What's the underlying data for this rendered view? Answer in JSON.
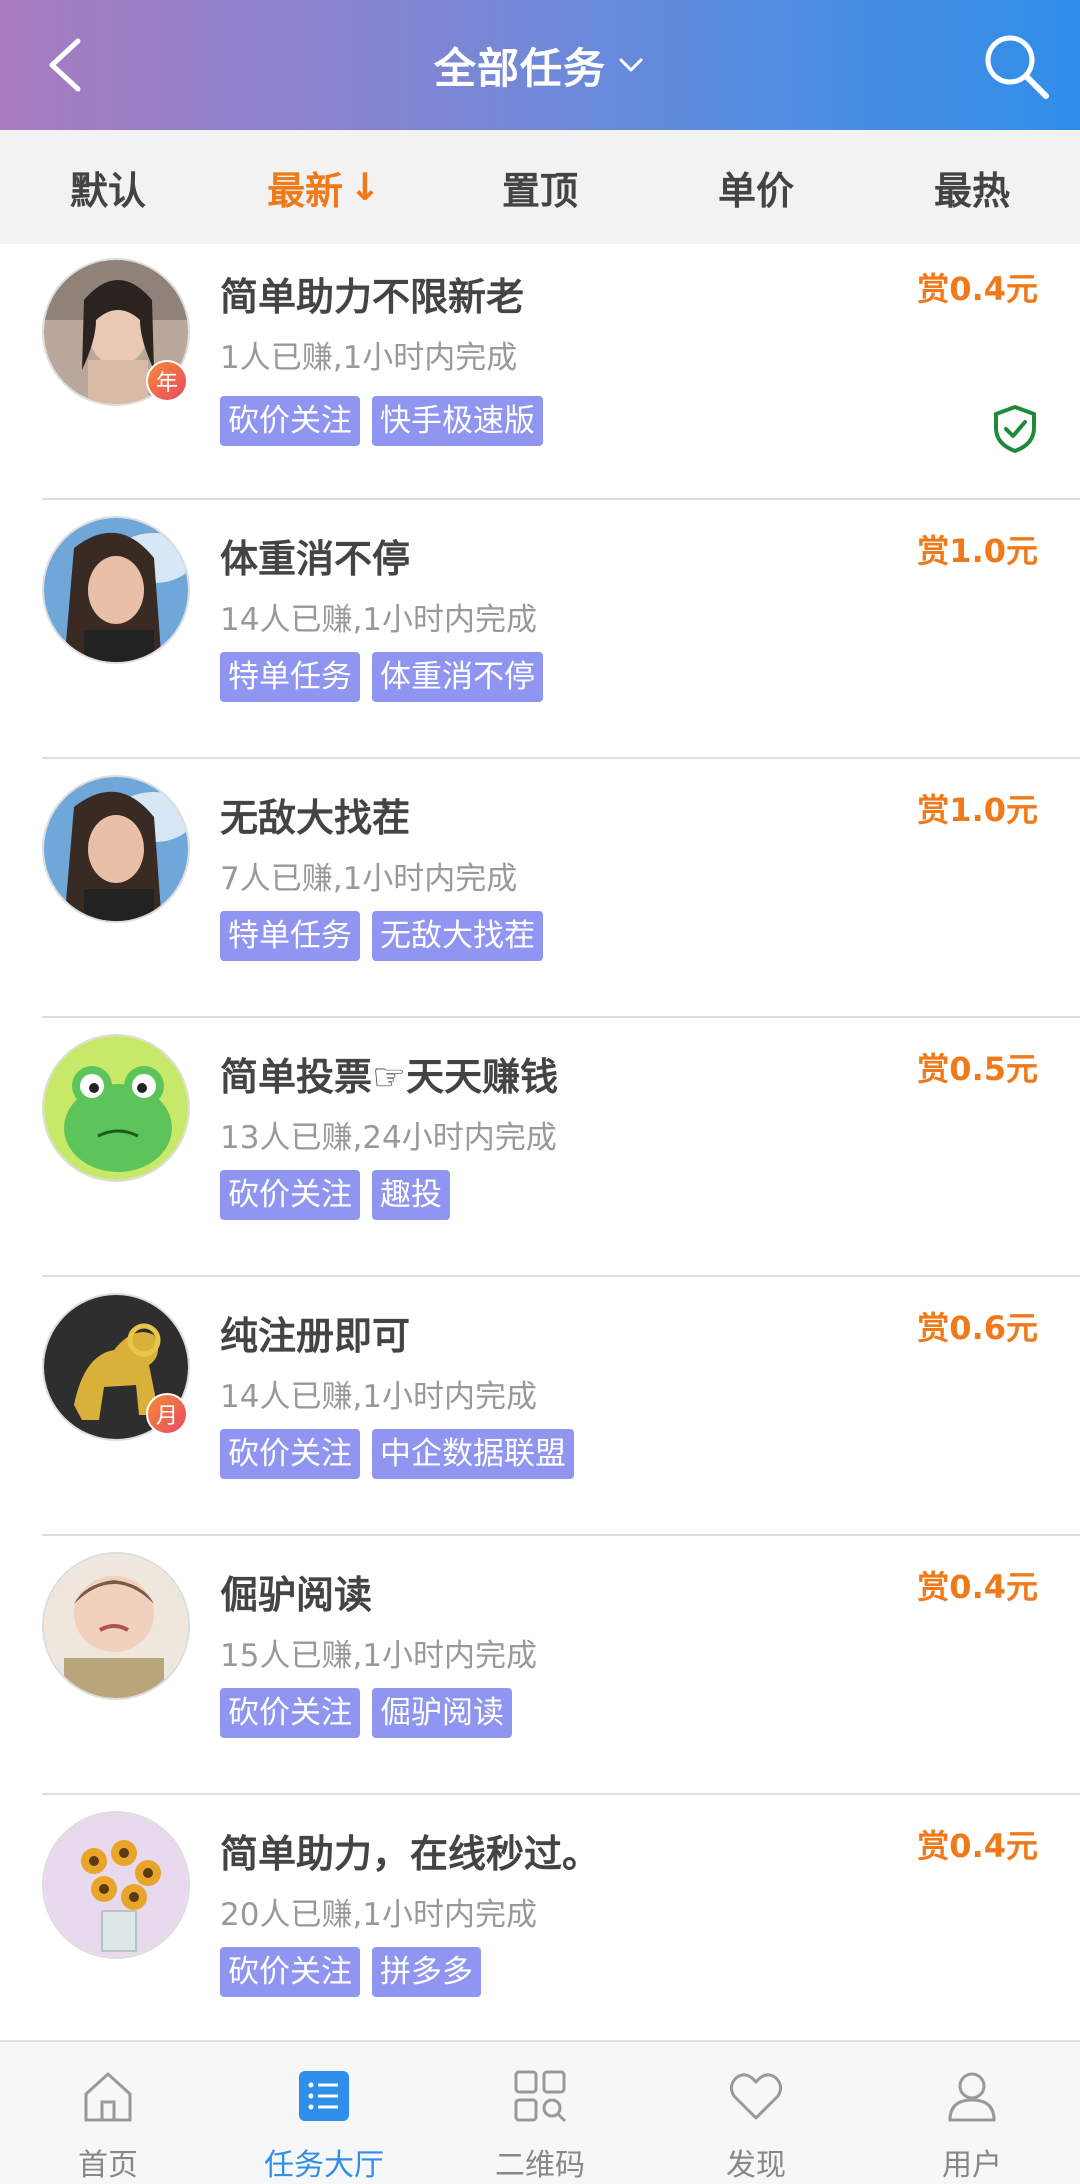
{
  "header": {
    "title": "全部任务",
    "icons": {
      "back": "chevron-left-icon",
      "dropdown": "chevron-down-icon",
      "search": "search-icon"
    },
    "colors": {
      "gradient_start": "#a87bbf",
      "gradient_end": "#2f8ee8"
    }
  },
  "sort": {
    "items": [
      {
        "label": "默认",
        "active": false
      },
      {
        "label": "最新",
        "active": true,
        "arrow": "↓"
      },
      {
        "label": "置顶",
        "active": false
      },
      {
        "label": "单价",
        "active": false
      },
      {
        "label": "最热",
        "active": false
      }
    ],
    "active_color": "#f07a1a"
  },
  "tasks": [
    {
      "title": "简单助力不限新老",
      "meta": "1人已赚,1小时内完成",
      "tags": [
        "砍价关注",
        "快手极速版"
      ],
      "reward": "赏0.4元",
      "badge": "年",
      "verified": true
    },
    {
      "title": "体重消不停",
      "meta": "14人已赚,1小时内完成",
      "tags": [
        "特单任务",
        "体重消不停"
      ],
      "reward": "赏1.0元",
      "badge": "",
      "verified": false
    },
    {
      "title": "无敌大找茬",
      "meta": "7人已赚,1小时内完成",
      "tags": [
        "特单任务",
        "无敌大找茬"
      ],
      "reward": "赏1.0元",
      "badge": "",
      "verified": false
    },
    {
      "title": "简单投票☞天天赚钱",
      "meta": "13人已赚,24小时内完成",
      "tags": [
        "砍价关注",
        "趣投"
      ],
      "reward": "赏0.5元",
      "badge": "",
      "verified": false
    },
    {
      "title": "纯注册即可",
      "meta": "14人已赚,1小时内完成",
      "tags": [
        "砍价关注",
        "中企数据联盟"
      ],
      "reward": "赏0.6元",
      "badge": "月",
      "verified": false
    },
    {
      "title": "倔驴阅读",
      "meta": "15人已赚,1小时内完成",
      "tags": [
        "砍价关注",
        "倔驴阅读"
      ],
      "reward": "赏0.4元",
      "badge": "",
      "verified": false
    },
    {
      "title": "简单助力，在线秒过。",
      "meta": "20人已赚,1小时内完成",
      "tags": [
        "砍价关注",
        "拼多多"
      ],
      "reward": "赏0.4元",
      "badge": "",
      "verified": false
    }
  ],
  "nav": {
    "items": [
      {
        "label": "首页",
        "icon": "home-icon",
        "active": false
      },
      {
        "label": "任务大厅",
        "icon": "task-list-icon",
        "active": true
      },
      {
        "label": "二维码",
        "icon": "qrcode-icon",
        "active": false
      },
      {
        "label": "发现",
        "icon": "heart-icon",
        "active": false
      },
      {
        "label": "用户",
        "icon": "user-icon",
        "active": false
      }
    ],
    "active_color": "#2f8ee8"
  }
}
